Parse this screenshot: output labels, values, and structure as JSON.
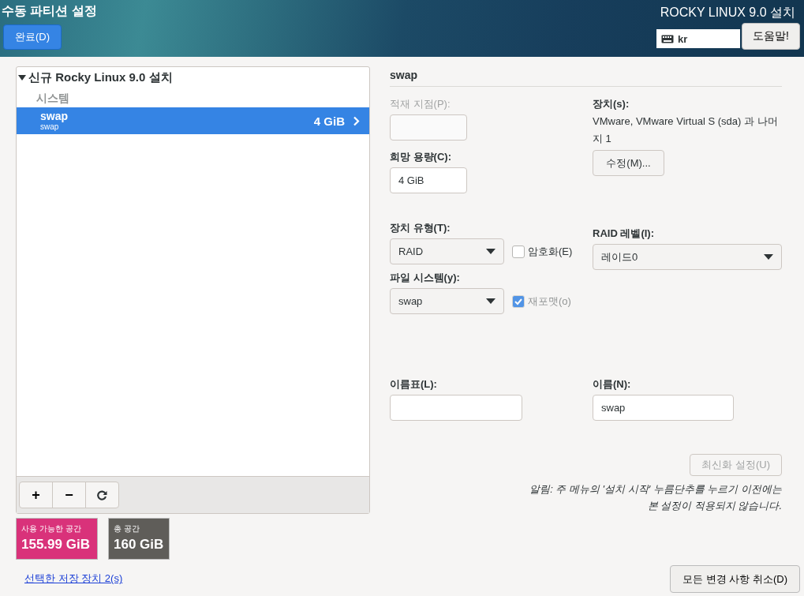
{
  "header": {
    "title": "수동 파티션 설정",
    "done_button": "완료(D)",
    "product": "ROCKY LINUX 9.0 설치",
    "keyboard": "kr",
    "help_button": "도움말!"
  },
  "installation": {
    "title": "신규 Rocky Linux 9.0 설치",
    "expanded": true,
    "children": [
      {
        "label": "시스템",
        "children": [
          {
            "name": "swap",
            "subtitle": "swap",
            "size": "4 GiB",
            "selected": true
          }
        ]
      }
    ]
  },
  "toolbar": {
    "add": "+",
    "remove": "−"
  },
  "space": [
    {
      "label": "사용 가능한 공간",
      "value": "155.99 GiB",
      "color": "#d9327a"
    },
    {
      "label": "총 공간",
      "value": "160 GiB",
      "color": "#5f5d59"
    }
  ],
  "storage_link": "선택한 저장 장치 2(s)",
  "reset_button": "모든 변경 사항 취소(D)",
  "details": {
    "title": "swap",
    "mount_point": {
      "label": "적재 지점(P):",
      "disabled": true
    },
    "desired_capacity": {
      "label": "희망 용량(C):",
      "value": "4 GiB"
    },
    "devices": {
      "label": "장치(s):",
      "text": "VMware, VMware Virtual S (sda) 과 나머지 1",
      "button": "수정(M)..."
    },
    "device_type": {
      "label": "장치 유형(T):",
      "value": "RAID"
    },
    "encrypt": {
      "label": "암호화(E)",
      "checked": false
    },
    "raid_level": {
      "label": "RAID 레벨(I):",
      "value": "레이드0"
    },
    "filesystem": {
      "label": "파일 시스템(y):",
      "value": "swap"
    },
    "reformat": {
      "label": "재포맷(o)",
      "checked": true,
      "disabled": true
    },
    "label_field": {
      "label": "이름표(L):"
    },
    "name_field": {
      "label": "이름(N):",
      "value": "swap"
    },
    "update_button": {
      "label": "최신화 설정(U)",
      "disabled": true
    },
    "note": "알림: 주 메뉴의 '설치 시작' 누름단추를 누르기 이전에는 본 설정이 적용되지 않습니다."
  }
}
